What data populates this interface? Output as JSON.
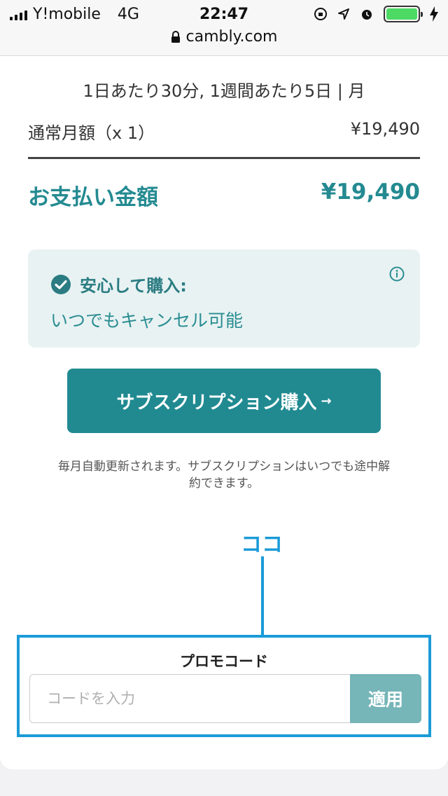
{
  "status_bar": {
    "carrier": "Y!mobile",
    "network": "4G",
    "time": "22:47"
  },
  "browser": {
    "url": "cambly.com"
  },
  "plan": {
    "description": "1日あたり30分, 1週間あたり5日 | 月",
    "regular_label": "通常月額（x 1）",
    "regular_price": "¥19,490",
    "total_label": "お支払い金額",
    "total_price": "¥19,490"
  },
  "assurance": {
    "title": "安心して購入:",
    "subtitle": "いつでもキャンセル可能"
  },
  "purchase": {
    "button_label": "サブスクリプション購入",
    "button_arrow": "→",
    "note": "毎月自動更新されます。サブスクリプションはいつでも途中解約できます。"
  },
  "annotation": {
    "label": "ココ"
  },
  "promo": {
    "title": "プロモコード",
    "placeholder": "コードを入力",
    "value": "",
    "apply_label": "適用"
  },
  "colors": {
    "accent": "#218a91",
    "highlight": "#1b9bd8",
    "assure_bg": "#e8f2f2"
  }
}
